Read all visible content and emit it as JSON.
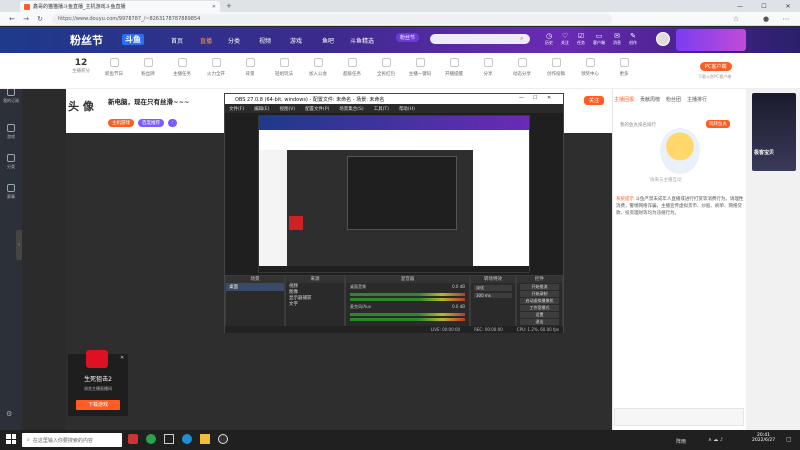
{
  "browser": {
    "tab_title": "鑫哥的猫猫播斗鱼直播_主机游戏斗鱼直播",
    "url": "https://www.douyu.com/9978787_/~8263178787889854",
    "window_controls": [
      "—",
      "☐",
      "✕"
    ]
  },
  "site": {
    "logo": "粉丝节",
    "logo2": "斗鱼",
    "nav": [
      "首页",
      "直播",
      "分类",
      "视频",
      "游戏",
      "鱼吧",
      "斗鱼精选"
    ],
    "badge": "粉丝节",
    "user_menu": [
      "历史",
      "关注",
      "任务",
      "客户端",
      "消息",
      "创作"
    ],
    "pc_btn": "PC客户端",
    "pc_sub": "下载斗鱼PC客户端"
  },
  "subbar": {
    "count": "12",
    "count_label": "主播积分",
    "items": [
      "新鱼节日",
      "粉丝牌",
      "主播任务",
      "火力全开",
      "背景",
      "轻组玩法",
      "加入公会",
      "超级任务",
      "全民红包",
      "主播一键码",
      "开播提醒",
      "分享",
      "动态分享",
      "创作投稿",
      "领奖中心",
      "更多"
    ],
    "report": "举报"
  },
  "room": {
    "title": "新电脑，现在只有丝滑~~~",
    "avatar_text": "头 像",
    "tag1": "主机游戏",
    "tag2": "百度推荐",
    "follow_btn": "关注"
  },
  "leftnav": [
    "关注",
    "我的订阅",
    "游戏",
    "分类",
    "赛事"
  ],
  "obs": {
    "title": "OBS 27.0.8 (64-bit, windows) - 配置文件: 未命名 - 场景: 未命名",
    "menu": [
      "文件(F)",
      "编辑(E)",
      "视图(V)",
      "配置文件(P)",
      "场景集合(S)",
      "工具(T)",
      "帮助(H)"
    ],
    "docks": {
      "scenes": "场景",
      "sources": "来源",
      "mixer": "混音器",
      "transitions": "转场特效",
      "controls": "控件"
    },
    "scene_list": [
      "桌面"
    ],
    "source_list": [
      "视频",
      "图像",
      "显示器捕获",
      "文字"
    ],
    "mixer_tracks": [
      "桌面音频",
      "麦克风/Aux"
    ],
    "mixer_levels": [
      "0.0 dB",
      "0.0 dB"
    ],
    "transition": "淡化",
    "transition_duration": "300 ms",
    "controls": [
      "开始推流",
      "开始录制",
      "启动虚拟摄像机",
      "工作室模式",
      "设置",
      "退出"
    ],
    "status": [
      "LIVE: 00:00:00",
      "REC: 00:00:00",
      "CPU: 1.2%, 60.00 fps"
    ]
  },
  "rightpanel": {
    "tabs": [
      "主播回报",
      "贡献周榜",
      "粉丝团",
      "主播排行"
    ],
    "rank_label": "我的鱼丸排名排行",
    "rank_btn": "玩转鱼丸",
    "empty_text": "快来与主播互动",
    "notice_title": "系统提示",
    "notice_text": "斗鱼严禁未成年人直播或进行打赏等消费行为。请理性消费，警惕网络诈骗，主播宣传虚拟货币、炒股、刷单、网络贷款、投资理财等均为违规行为。",
    "ad_text": "极客宝贝"
  },
  "gamead": {
    "title": "生死狙击2",
    "subtitle": "浏览主播直播间",
    "btn": "下载游戏"
  },
  "taskbar": {
    "search_placeholder": "在这里输入你要搜索的内容",
    "weather": "阵雨",
    "time": "20:41",
    "date": "2022/6/27"
  }
}
